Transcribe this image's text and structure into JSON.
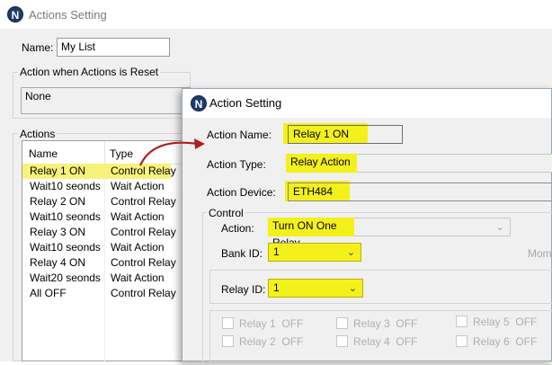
{
  "back_window": {
    "title": "Actions Setting",
    "app_icon_letter": "N",
    "name_label": "Name:",
    "name_value": "My List",
    "reset_group_label": "Action when Actions is Reset",
    "reset_value": "None",
    "actions_group_label": "Actions",
    "columns": [
      "Name",
      "Type"
    ],
    "rows": [
      {
        "name": "Relay 1 ON",
        "type": "Control Relay"
      },
      {
        "name": "Wait10 seonds",
        "type": "Wait Action"
      },
      {
        "name": "Relay 2 ON",
        "type": "Control Relay"
      },
      {
        "name": "Wait10 seonds",
        "type": "Wait Action"
      },
      {
        "name": "Relay 3 ON",
        "type": "Control Relay"
      },
      {
        "name": "Wait10 seonds",
        "type": "Wait Action"
      },
      {
        "name": "Relay 4 ON",
        "type": "Control Relay"
      },
      {
        "name": "Wait20 seonds",
        "type": "Wait Action"
      },
      {
        "name": "All OFF",
        "type": "Control Relay"
      }
    ]
  },
  "front_window": {
    "title": "Action Setting",
    "app_icon_letter": "N",
    "action_name_label": "Action Name:",
    "action_name_value": "Relay 1 ON",
    "action_type_label": "Action Type:",
    "action_type_value": "Relay Action",
    "action_device_label": "Action Device:",
    "action_device_value": "ETH484",
    "control_group_label": "Control",
    "action_label": "Action:",
    "action_value": "Turn ON One Relay",
    "bank_id_label": "Bank ID:",
    "bank_id_value": "1",
    "relay_id_label": "Relay ID:",
    "relay_id_value": "1",
    "truncated_label": "Mom",
    "relay_checkboxes": [
      {
        "label": "Relay 1",
        "state": "OFF"
      },
      {
        "label": "Relay 3",
        "state": "OFF"
      },
      {
        "label": "Relay 5",
        "state": "OFF"
      },
      {
        "label": "Relay 2",
        "state": "OFF"
      },
      {
        "label": "Relay 4",
        "state": "OFF"
      },
      {
        "label": "Relay 6",
        "state": "OFF"
      }
    ]
  },
  "colors": {
    "highlight_yellow": "#f4f01a",
    "annotation_arrow": "#b01e1e",
    "row_highlight": "#f7f37a"
  }
}
